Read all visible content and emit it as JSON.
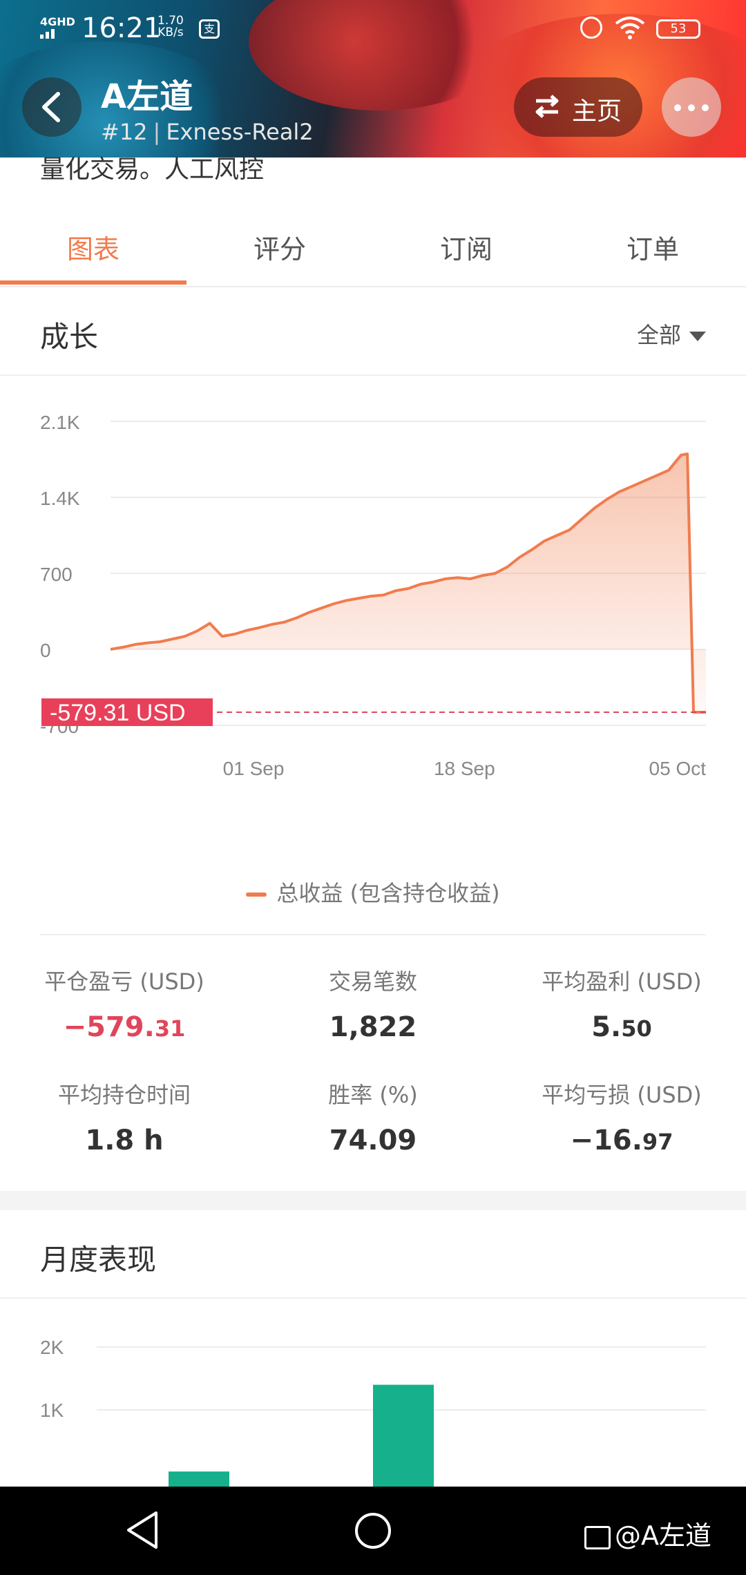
{
  "status_bar": {
    "signal": "4GHD",
    "time": "16:21",
    "speed_value": "1.70",
    "speed_unit": "KB/s",
    "app_icon": "支",
    "battery": "53"
  },
  "header": {
    "title": "A左道",
    "rank": "#12",
    "server": "Exness-Real2",
    "home_label": "主页"
  },
  "description": "量化交易。人工风控",
  "tabs": [
    {
      "label": "图表",
      "active": true
    },
    {
      "label": "评分",
      "active": false
    },
    {
      "label": "订阅",
      "active": false
    },
    {
      "label": "订单",
      "active": false
    }
  ],
  "growth": {
    "title": "成长",
    "filter": "全部"
  },
  "chart_data": [
    {
      "type": "area",
      "title": "成长",
      "y_ticks": [
        "2.1K",
        "1.4K",
        "700",
        "0",
        "-700"
      ],
      "y_tick_values": [
        2100,
        1400,
        700,
        0,
        -700
      ],
      "ylim": [
        -700,
        2100
      ],
      "x_ticks": [
        "01 Sep",
        "18 Sep",
        "05 Oct"
      ],
      "x_tick_positions": [
        14,
        31,
        48
      ],
      "xlim": [
        0,
        48
      ],
      "series": [
        {
          "name": "总收益 (包含持仓收益)",
          "color": "#f07c4e",
          "x": [
            0,
            1,
            2,
            3,
            4,
            5,
            6,
            7,
            8,
            9,
            10,
            11,
            12,
            13,
            14,
            15,
            16,
            17,
            18,
            19,
            20,
            21,
            22,
            23,
            24,
            25,
            26,
            27,
            28,
            29,
            30,
            31,
            32,
            33,
            34,
            35,
            36,
            37,
            38,
            39,
            40,
            41,
            42,
            43,
            44,
            45,
            46,
            46.5,
            47,
            48
          ],
          "values": [
            0,
            20,
            45,
            60,
            70,
            95,
            120,
            170,
            240,
            120,
            140,
            175,
            200,
            230,
            250,
            290,
            340,
            380,
            420,
            450,
            470,
            490,
            500,
            540,
            560,
            600,
            620,
            650,
            660,
            650,
            680,
            700,
            760,
            850,
            920,
            1000,
            1050,
            1100,
            1200,
            1300,
            1380,
            1450,
            1500,
            1550,
            1600,
            1650,
            1790,
            1800,
            -579.31,
            -579.31
          ]
        }
      ],
      "current_value_label": "-579.31 USD",
      "current_value": -579.31,
      "grid": true,
      "legend_position": "bottom-center"
    },
    {
      "type": "bar",
      "title": "月度表现",
      "y_ticks": [
        "2K",
        "1K"
      ],
      "y_tick_values": [
        2000,
        1000
      ],
      "categories": [
        "",
        "",
        "",
        ""
      ],
      "values": [
        20,
        0,
        1400,
        0
      ],
      "color": "#16b08d",
      "grid": true
    }
  ],
  "legend": {
    "label": "总收益 (包含持仓收益)"
  },
  "stats": [
    {
      "label": "平仓盈亏 (USD)",
      "int": "−579.",
      "dec": "31",
      "negative": true
    },
    {
      "label": "交易笔数",
      "int": "1,822",
      "dec": "",
      "negative": false
    },
    {
      "label": "平均盈利 (USD)",
      "int": "5.",
      "dec": "50",
      "negative": false
    },
    {
      "label": "平均持仓时间",
      "int": "1.8 h",
      "dec": "",
      "negative": false
    },
    {
      "label": "胜率 (%)",
      "int": "74.09",
      "dec": "",
      "negative": false
    },
    {
      "label": "平均亏损 (USD)",
      "int": "−16.",
      "dec": "97",
      "negative": false
    }
  ],
  "monthly": {
    "title": "月度表现"
  },
  "nav_bar": {
    "watermark": "@A左道"
  },
  "colors": {
    "accent": "#f07c4e",
    "negative": "#e0455b",
    "bar": "#16b08d"
  }
}
